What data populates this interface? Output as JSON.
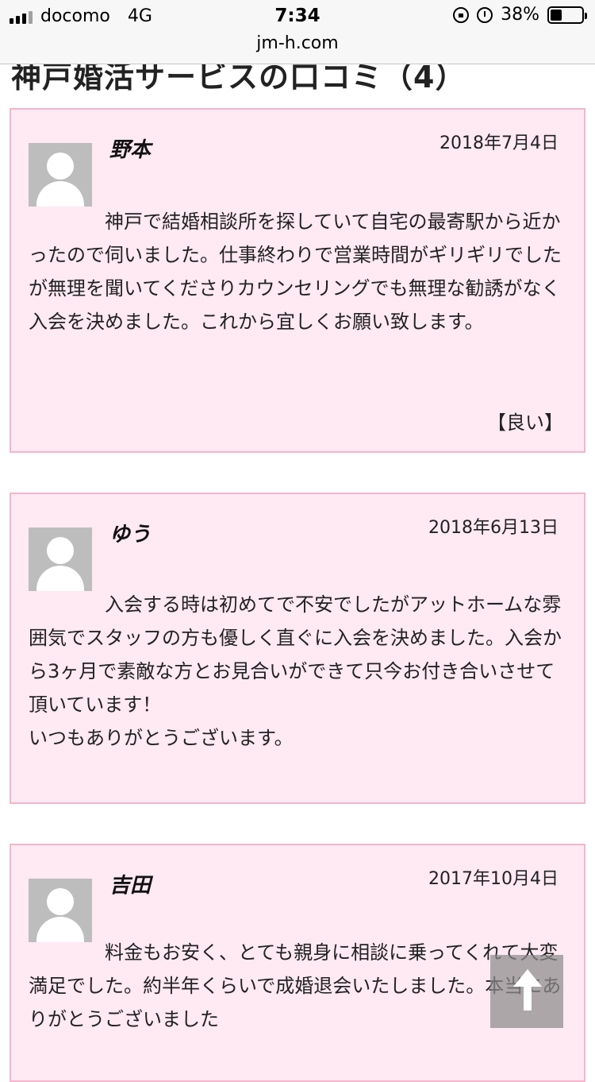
{
  "status_bar": {
    "carrier": "docomo",
    "network": "4G",
    "time": "7:34",
    "url": "jm-h.com",
    "battery": "38%",
    "battery_level": 0.38,
    "icons": [
      "signal-icon",
      "rotation-lock-icon",
      "alarm-icon",
      "battery-icon"
    ]
  },
  "page": {
    "heading": "神戸婚活サービスの口コミ（4）"
  },
  "reviews": [
    {
      "name": "野本",
      "date": "2018年7月4日",
      "text": "神戸で結婚相談所を探していて自宅の最寄駅から近かったので伺いました。仕事終わりで営業時間がギリギリでしたが無理を聞いてくださりカウンセリングでも無理な勧誘がなく入会を決めました。これから宜しくお願い致します。",
      "rating": "【良い】"
    },
    {
      "name": "ゆう",
      "date": "2018年6月13日",
      "text": "入会する時は初めてで不安でしたがアットホームな雰囲気でスタッフの方も優しく直ぐに入会を決めました。入会から3ヶ月で素敵な方とお見合いができて只今お付き合いさせて頂いています！\nいつもありがとうございます。"
    },
    {
      "name": "吉田",
      "date": "2017年10月4日",
      "text": "料金もお安く、とても親身に相談に乗ってくれて大変満足でした。約半年くらいで成婚退会いたしました。本当にありがとうございました"
    }
  ],
  "colors": {
    "card_bg": "#ffe9f3",
    "card_border": "#f5b5cc",
    "avatar_bg": "#bdbdbd"
  }
}
